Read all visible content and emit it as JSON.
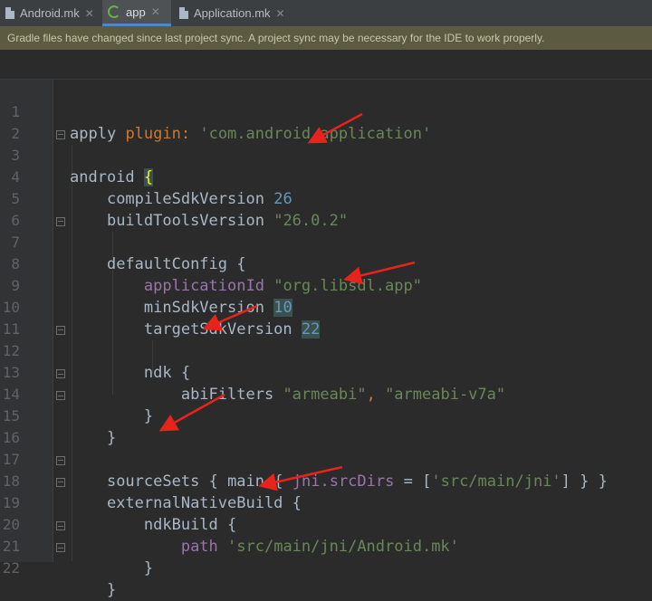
{
  "tabs": [
    {
      "label": "Android.mk",
      "icon": "file-icon",
      "active": false
    },
    {
      "label": "app",
      "icon": "gradle-icon",
      "active": true
    },
    {
      "label": "Application.mk",
      "icon": "file-icon",
      "active": false
    }
  ],
  "close_glyph": "✕",
  "banner": {
    "text": "Gradle files have changed since last project sync. A project sync may be necessary for the IDE to work properly."
  },
  "lines": [
    {
      "n": "1"
    },
    {
      "n": "2"
    },
    {
      "n": "3"
    },
    {
      "n": "4"
    },
    {
      "n": "5"
    },
    {
      "n": "6"
    },
    {
      "n": "7"
    },
    {
      "n": "8"
    },
    {
      "n": "9"
    },
    {
      "n": "10"
    },
    {
      "n": "11"
    },
    {
      "n": "12"
    },
    {
      "n": "13"
    },
    {
      "n": "14"
    },
    {
      "n": "15"
    },
    {
      "n": "16"
    },
    {
      "n": "17"
    },
    {
      "n": "18"
    },
    {
      "n": "19"
    },
    {
      "n": "20"
    },
    {
      "n": "21"
    },
    {
      "n": "22"
    }
  ],
  "code": {
    "l1_a": "apply",
    "l1_b": "plugin:",
    "l1_c": "'com.android.application'",
    "l3_a": "android",
    "l3_b": "{",
    "l4_a": "compileSdkVersion",
    "l4_b": "26",
    "l5_a": "buildToolsVersion",
    "l5_b": "\"26.0.2\"",
    "l7_a": "defaultConfig",
    "l7_b": "{",
    "l8_a": "applicationId",
    "l8_b": "\"org.libsdl.app\"",
    "l9_a": "minSdkVersion",
    "l9_b": "10",
    "l10_a": "targetSdkVersion",
    "l10_b": "22",
    "l12_a": "ndk",
    "l12_b": "{",
    "l13_a": "abiFilters",
    "l13_b": "\"armeabi\"",
    "l13_c": ",",
    "l13_d": "\"armeabi-v7a\"",
    "l14": "}",
    "l15": "}",
    "l17_a": "sourceSets",
    "l17_b": "{",
    "l17_c": "main",
    "l17_d": "{",
    "l17_e": "jni.srcDirs",
    "l17_f": "=",
    "l17_g": "[",
    "l17_h": "'src/main/jni'",
    "l17_i": "]",
    "l17_j": "}",
    "l17_k": "}",
    "l18_a": "externalNativeBuild",
    "l18_b": "{",
    "l19_a": "ndkBuild",
    "l19_b": "{",
    "l20_a": "path",
    "l20_b": "'src/main/jni/Android.mk'",
    "l21": "}",
    "l22": "}"
  },
  "colors": {
    "background": "#2b2b2b",
    "keyword": "#cc7832",
    "string": "#6a8759",
    "number": "#6897bb",
    "property": "#9876aa",
    "annotation_arrow": "#e8231c"
  }
}
